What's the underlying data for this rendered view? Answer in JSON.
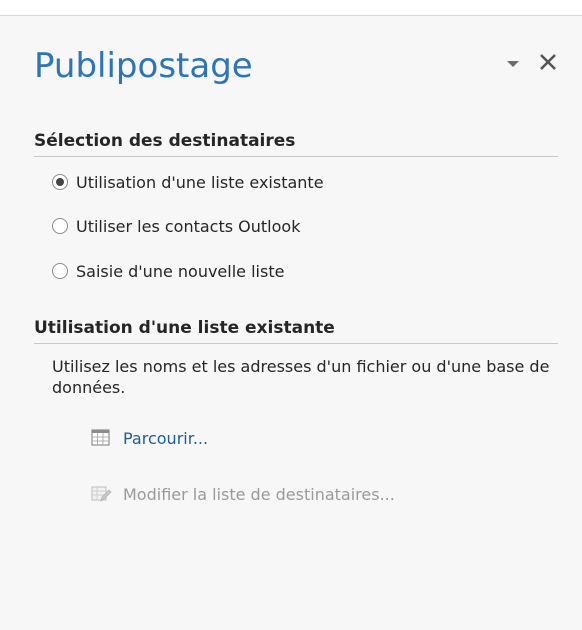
{
  "pane": {
    "title": "Publipostage",
    "menu_icon": "dropdown-triangle-icon",
    "close_icon": "close-icon"
  },
  "recipients_section": {
    "header": "Sélection des destinataires",
    "options": [
      {
        "label": "Utilisation d'une liste existante",
        "checked": true
      },
      {
        "label": "Utiliser les contacts Outlook",
        "checked": false
      },
      {
        "label": "Saisie d'une nouvelle liste",
        "checked": false
      }
    ]
  },
  "existing_list_section": {
    "header": "Utilisation d'une liste existante",
    "description": "Utilisez les noms et les adresses d'un fichier ou d'une base de données.",
    "browse": {
      "label": "Parcourir...",
      "icon": "table-icon"
    },
    "edit": {
      "label": "Modifier la liste de destinataires...",
      "icon": "edit-list-icon",
      "enabled": false
    }
  },
  "colors": {
    "title": "#2e75b6",
    "link": "#1f5c99",
    "disabled": "#9a9a9a",
    "pane_background": "#f7f7f7"
  }
}
